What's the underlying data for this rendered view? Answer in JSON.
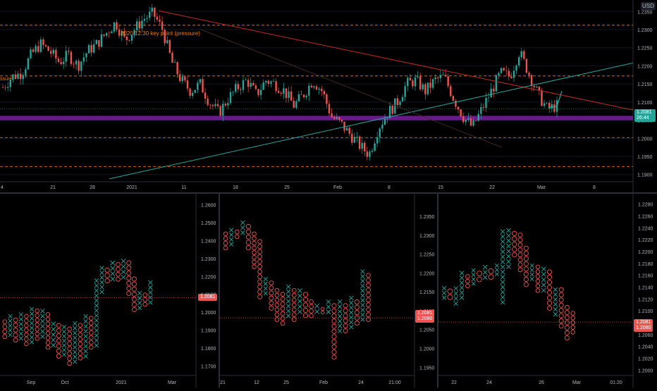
{
  "main": {
    "currency": "USD",
    "annotation": "2020.12.30 key point (pressure)",
    "left_label": "ssure",
    "price_ticks": [
      "1.2350",
      "1.2300",
      "1.2250",
      "1.2200",
      "1.2150",
      "1.2100",
      "1.2050",
      "1.2000",
      "1.1950",
      "1.1900"
    ],
    "time_ticks": [
      "4",
      "21",
      "28",
      "2021",
      "11",
      "18",
      "25",
      "Feb",
      "8",
      "15",
      "22",
      "Mar",
      "8"
    ],
    "current_price": "1.2081",
    "countdown": "26:44",
    "colors": {
      "up": "#26a69a",
      "down": "#ef5350",
      "purple": "#7b1fa2",
      "teal": "#26a69a",
      "red": "#b71c1c",
      "orange": "#f57c00"
    }
  },
  "pnf_panels": [
    {
      "price_ticks": [
        "1.2600",
        "1.2500",
        "1.2400",
        "1.2300",
        "1.2200",
        "1.2100",
        "1.2000",
        "1.1900",
        "1.1800",
        "1.1700"
      ],
      "time_ticks": [
        "Sep",
        "Oct",
        "2021",
        "Mar"
      ],
      "current_price": "1.2081"
    },
    {
      "price_ticks": [
        "1.2350",
        "1.2300",
        "1.2250",
        "1.2200",
        "1.2150",
        "1.2100",
        "1.2050",
        "1.2000",
        "1.1950"
      ],
      "time_ticks": [
        "21",
        "12",
        "25",
        "Feb",
        "24",
        "21:00"
      ],
      "current_price": "1.2081",
      "sub_price": "1.2080"
    },
    {
      "price_ticks": [
        "1.2280",
        "1.2260",
        "1.2240",
        "1.2220",
        "1.2200",
        "1.2180",
        "1.2160",
        "1.2140",
        "1.2120",
        "1.2100",
        "1.2080",
        "1.2060",
        "1.2040",
        "1.2020",
        "1.2000"
      ],
      "time_ticks": [
        "22",
        "24",
        "26",
        "Mar",
        "01:20"
      ],
      "current_price": "1.2081",
      "sub_price": "1.2080"
    }
  ],
  "chart_data": [
    {
      "type": "candlestick",
      "title": "",
      "ylim": [
        1.188,
        1.237
      ],
      "x_ticks": [
        "4",
        "21",
        "28",
        "2021",
        "11",
        "18",
        "25",
        "Feb",
        "8",
        "15",
        "22",
        "Mar",
        "8"
      ],
      "close_path": [
        1.214,
        1.217,
        1.218,
        1.223,
        1.226,
        1.224,
        1.221,
        1.223,
        1.22,
        1.224,
        1.226,
        1.229,
        1.232,
        1.227,
        1.23,
        1.233,
        1.2345,
        1.23,
        1.221,
        1.216,
        1.213,
        1.215,
        1.21,
        1.207,
        1.211,
        1.214,
        1.216,
        1.212,
        1.216,
        1.215,
        1.213,
        1.209,
        1.212,
        1.216,
        1.213,
        1.206,
        1.204,
        1.201,
        1.198,
        1.1955,
        1.203,
        1.207,
        1.21,
        1.215,
        1.216,
        1.213,
        1.216,
        1.217,
        1.211,
        1.206,
        1.203,
        1.208,
        1.213,
        1.218,
        1.217,
        1.224,
        1.218,
        1.212,
        1.208,
        1.209
      ],
      "current_price": 1.2081,
      "purple_band": [
        1.205,
        1.2062
      ],
      "dashed_levels": [
        1.2312,
        1.2172,
        1.2002,
        1.1922
      ]
    },
    {
      "type": "point-and-figure",
      "ylim": [
        1.165,
        1.263
      ],
      "columns": [
        {
          "t": "o",
          "lo": 1.185,
          "hi": 1.196
        },
        {
          "t": "x",
          "lo": 1.186,
          "hi": 1.199
        },
        {
          "t": "o",
          "lo": 1.183,
          "hi": 1.197
        },
        {
          "t": "x",
          "lo": 1.184,
          "hi": 1.2
        },
        {
          "t": "o",
          "lo": 1.181,
          "hi": 1.199
        },
        {
          "t": "x",
          "lo": 1.182,
          "hi": 1.203
        },
        {
          "t": "o",
          "lo": 1.184,
          "hi": 1.202
        },
        {
          "t": "x",
          "lo": 1.185,
          "hi": 1.202
        },
        {
          "t": "o",
          "lo": 1.179,
          "hi": 1.2
        },
        {
          "t": "x",
          "lo": 1.18,
          "hi": 1.195
        },
        {
          "t": "o",
          "lo": 1.174,
          "hi": 1.194
        },
        {
          "t": "x",
          "lo": 1.175,
          "hi": 1.193
        },
        {
          "t": "o",
          "lo": 1.17,
          "hi": 1.192
        },
        {
          "t": "x",
          "lo": 1.171,
          "hi": 1.195
        },
        {
          "t": "o",
          "lo": 1.173,
          "hi": 1.194
        },
        {
          "t": "x",
          "lo": 1.174,
          "hi": 1.199
        },
        {
          "t": "o",
          "lo": 1.179,
          "hi": 1.198
        },
        {
          "t": "x",
          "lo": 1.18,
          "hi": 1.219
        },
        {
          "t": "x",
          "lo": 1.21,
          "hi": 1.226
        },
        {
          "t": "o",
          "lo": 1.216,
          "hi": 1.225
        },
        {
          "t": "x",
          "lo": 1.217,
          "hi": 1.229
        },
        {
          "t": "o",
          "lo": 1.217,
          "hi": 1.228
        },
        {
          "t": "x",
          "lo": 1.218,
          "hi": 1.23
        },
        {
          "t": "o",
          "lo": 1.209,
          "hi": 1.229
        },
        {
          "t": "o",
          "lo": 1.2,
          "hi": 1.22
        },
        {
          "t": "x",
          "lo": 1.201,
          "hi": 1.212
        },
        {
          "t": "o",
          "lo": 1.203,
          "hi": 1.211
        },
        {
          "t": "x",
          "lo": 1.204,
          "hi": 1.218
        }
      ]
    },
    {
      "type": "point-and-figure",
      "ylim": [
        1.193,
        1.2395
      ],
      "columns": [
        {
          "t": "o",
          "lo": 1.226,
          "hi": 1.231
        },
        {
          "t": "x",
          "lo": 1.227,
          "hi": 1.232
        },
        {
          "t": "o",
          "lo": 1.229,
          "hi": 1.2315
        },
        {
          "t": "x",
          "lo": 1.23,
          "hi": 1.234
        },
        {
          "t": "o",
          "lo": 1.226,
          "hi": 1.233
        },
        {
          "t": "o",
          "lo": 1.221,
          "hi": 1.231
        },
        {
          "t": "o",
          "lo": 1.213,
          "hi": 1.229
        },
        {
          "t": "x",
          "lo": 1.214,
          "hi": 1.219
        },
        {
          "t": "o",
          "lo": 1.21,
          "hi": 1.218
        },
        {
          "t": "o",
          "lo": 1.207,
          "hi": 1.216
        },
        {
          "t": "o",
          "lo": 1.206,
          "hi": 1.215
        },
        {
          "t": "x",
          "lo": 1.208,
          "hi": 1.217
        },
        {
          "t": "o",
          "lo": 1.207,
          "hi": 1.216
        },
        {
          "t": "x",
          "lo": 1.209,
          "hi": 1.216
        },
        {
          "t": "o",
          "lo": 1.208,
          "hi": 1.215
        },
        {
          "t": "o",
          "lo": 1.208,
          "hi": 1.213
        },
        {
          "t": "x",
          "lo": 1.209,
          "hi": 1.212
        },
        {
          "t": "o",
          "lo": 1.209,
          "hi": 1.211
        },
        {
          "t": "x",
          "lo": 1.209,
          "hi": 1.213
        },
        {
          "t": "o",
          "lo": 1.197,
          "hi": 1.212
        },
        {
          "t": "x",
          "lo": 1.204,
          "hi": 1.213
        },
        {
          "t": "o",
          "lo": 1.204,
          "hi": 1.212
        },
        {
          "t": "x",
          "lo": 1.205,
          "hi": 1.214
        },
        {
          "t": "o",
          "lo": 1.206,
          "hi": 1.213
        },
        {
          "t": "x",
          "lo": 1.207,
          "hi": 1.221
        },
        {
          "t": "o",
          "lo": 1.207,
          "hi": 1.22
        }
      ]
    },
    {
      "type": "point-and-figure",
      "ylim": [
        1.1992,
        1.2288
      ],
      "columns": [
        {
          "t": "x",
          "lo": 1.2118,
          "hi": 1.2142
        },
        {
          "t": "o",
          "lo": 1.2118,
          "hi": 1.2138
        },
        {
          "t": "x",
          "lo": 1.2108,
          "hi": 1.2142
        },
        {
          "t": "x",
          "lo": 1.2118,
          "hi": 1.2168
        },
        {
          "t": "o",
          "lo": 1.2138,
          "hi": 1.2162
        },
        {
          "t": "x",
          "lo": 1.2142,
          "hi": 1.2172
        },
        {
          "t": "o",
          "lo": 1.2148,
          "hi": 1.2168
        },
        {
          "t": "x",
          "lo": 1.2152,
          "hi": 1.2178
        },
        {
          "t": "o",
          "lo": 1.2152,
          "hi": 1.2172
        },
        {
          "t": "x",
          "lo": 1.2158,
          "hi": 1.218
        },
        {
          "t": "x",
          "lo": 1.211,
          "hi": 1.2238
        },
        {
          "t": "x",
          "lo": 1.217,
          "hi": 1.224
        },
        {
          "t": "o",
          "lo": 1.219,
          "hi": 1.2235
        },
        {
          "t": "o",
          "lo": 1.2165,
          "hi": 1.2232
        },
        {
          "t": "o",
          "lo": 1.214,
          "hi": 1.221
        },
        {
          "t": "x",
          "lo": 1.215,
          "hi": 1.218
        },
        {
          "t": "o",
          "lo": 1.213,
          "hi": 1.2178
        },
        {
          "t": "x",
          "lo": 1.213,
          "hi": 1.2175
        },
        {
          "t": "o",
          "lo": 1.21,
          "hi": 1.217
        },
        {
          "t": "x",
          "lo": 1.209,
          "hi": 1.214
        },
        {
          "t": "o",
          "lo": 1.207,
          "hi": 1.214
        },
        {
          "t": "o",
          "lo": 1.205,
          "hi": 1.211
        },
        {
          "t": "o",
          "lo": 1.206,
          "hi": 1.21
        }
      ]
    }
  ]
}
